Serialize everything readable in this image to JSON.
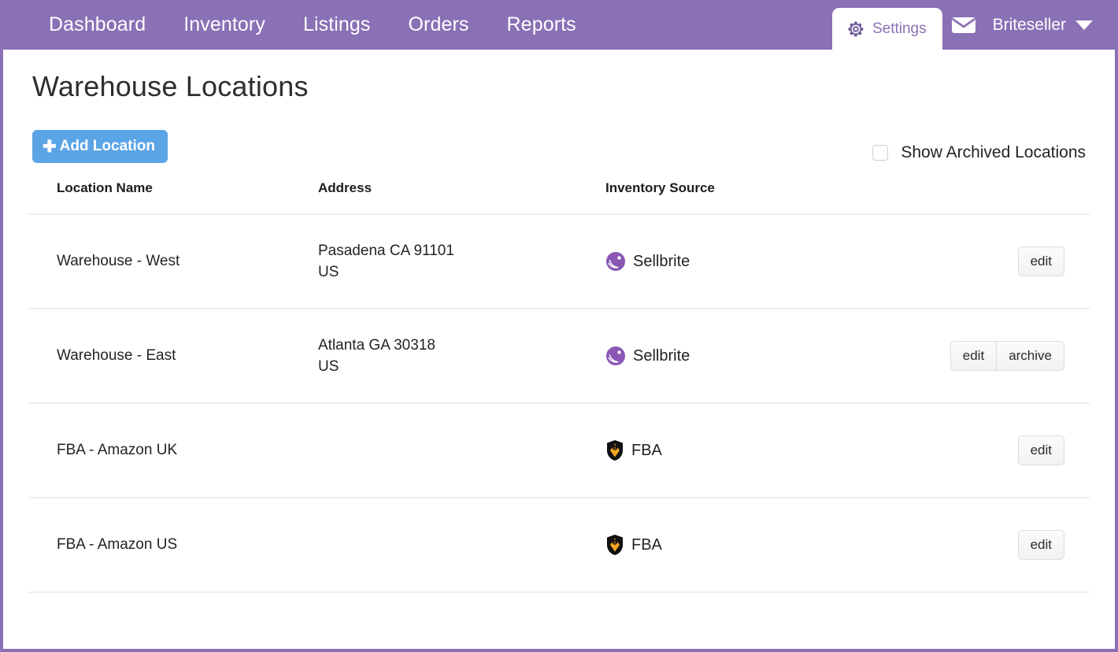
{
  "nav": {
    "items": [
      {
        "label": "Dashboard"
      },
      {
        "label": "Inventory"
      },
      {
        "label": "Listings"
      },
      {
        "label": "Orders"
      },
      {
        "label": "Reports"
      }
    ],
    "settings_tab": {
      "label": "Settings",
      "icon": "gear-icon",
      "active": true
    },
    "mail_icon": "envelope-icon",
    "account": {
      "name": "Briteseller",
      "caret": "chevron-down-icon"
    },
    "bar_color": "#8a70b5",
    "active_tab_text_color": "#8a70b5"
  },
  "page": {
    "title": "Warehouse Locations"
  },
  "toolbar": {
    "add_button": {
      "label": "Add Location",
      "icon": "plus-icon",
      "color": "#5ba4e5"
    },
    "archive_toggle": {
      "label": "Show Archived Locations",
      "checked": false
    }
  },
  "table": {
    "columns": [
      {
        "key": "name",
        "label": "Location Name"
      },
      {
        "key": "address",
        "label": "Address"
      },
      {
        "key": "source",
        "label": "Inventory Source"
      },
      {
        "key": "actions",
        "label": ""
      }
    ],
    "rows": [
      {
        "name": "Warehouse - West",
        "address_line1": "Pasadena CA 91101",
        "address_line2": "US",
        "source_label": "Sellbrite",
        "source_icon": "sellbrite-logo-icon",
        "actions": [
          "edit"
        ]
      },
      {
        "name": "Warehouse - East",
        "address_line1": "Atlanta GA 30318",
        "address_line2": "US",
        "source_label": "Sellbrite",
        "source_icon": "sellbrite-logo-icon",
        "actions": [
          "edit",
          "archive"
        ]
      },
      {
        "name": "FBA - Amazon UK",
        "address_line1": "",
        "address_line2": "",
        "source_label": "FBA",
        "source_icon": "amazon-fba-shield-icon",
        "actions": [
          "edit"
        ]
      },
      {
        "name": "FBA - Amazon US",
        "address_line1": "",
        "address_line2": "",
        "source_label": "FBA",
        "source_icon": "amazon-fba-shield-icon",
        "actions": [
          "edit"
        ]
      }
    ]
  }
}
